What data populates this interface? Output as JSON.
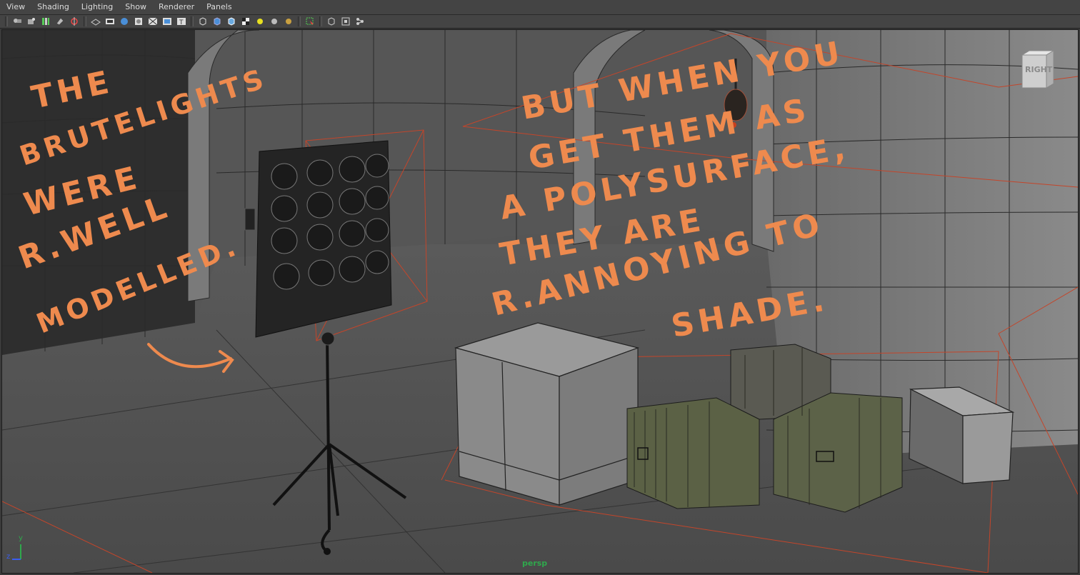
{
  "menu": {
    "items": [
      {
        "label": "View"
      },
      {
        "label": "Shading"
      },
      {
        "label": "Lighting"
      },
      {
        "label": "Show"
      },
      {
        "label": "Renderer"
      },
      {
        "label": "Panels"
      }
    ]
  },
  "toolbar": {
    "icons": [
      "camera-select-icon",
      "camera-attributes-icon",
      "bookmark-icon",
      "image-plane-icon",
      "2d-pan-zoom-icon",
      "grid-icon",
      "film-gate-icon",
      "resolution-gate-icon",
      "gate-mask-icon",
      "field-chart-icon",
      "safe-action-icon",
      "safe-title-icon",
      "wireframe-icon",
      "smooth-shade-icon",
      "wireframe-on-shaded-icon",
      "textured-icon",
      "use-all-lights-icon",
      "shadows-icon",
      "ambient-occlusion-icon",
      "isolate-select-icon",
      "xray-icon",
      "xray-joints-icon",
      "xray-components-icon"
    ]
  },
  "viewport": {
    "viewcube_label": "RIGHT",
    "camera_label": "persp",
    "axis_y_label": "y",
    "axis_z_label": "z"
  },
  "annotations": {
    "note_left": [
      "THE",
      "BRUTELIGHTS",
      "WERE",
      "R.WELL",
      "MODELLED."
    ],
    "note_right": [
      "BUT WHEN YOU",
      "GET THEM AS",
      "A POLYSURFACE,",
      "THEY ARE",
      "R.ANNOYING TO",
      "SHADE."
    ],
    "ink_color": "#ee8a4e"
  },
  "colors": {
    "menubar_bg": "#444444",
    "viewport_bg": "#555555",
    "wire_orange": "#c4452a",
    "camera_label": "#2fa84c"
  }
}
